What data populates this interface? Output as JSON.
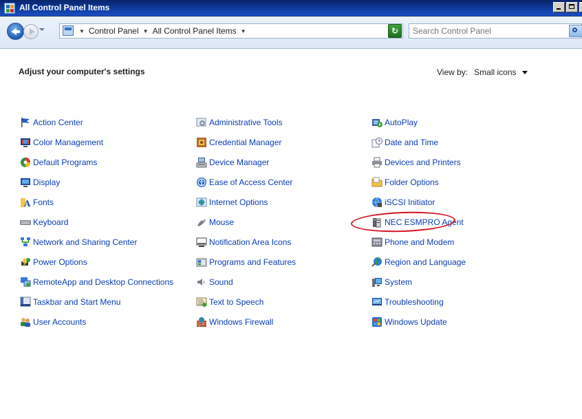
{
  "window": {
    "title": "All Control Panel Items"
  },
  "address": {
    "crumbs": [
      "Control Panel",
      "All Control Panel Items"
    ],
    "search_placeholder": "Search Control Panel"
  },
  "main": {
    "heading": "Adjust your computer's settings",
    "view_by_label": "View by:",
    "view_by_value": "Small icons"
  },
  "items": {
    "col1": [
      {
        "label": "Action Center",
        "icon": "flag-icon"
      },
      {
        "label": "Color Management",
        "icon": "color-monitor-icon"
      },
      {
        "label": "Default Programs",
        "icon": "default-programs-icon"
      },
      {
        "label": "Display",
        "icon": "display-icon"
      },
      {
        "label": "Fonts",
        "icon": "fonts-icon"
      },
      {
        "label": "Keyboard",
        "icon": "keyboard-icon"
      },
      {
        "label": "Network and Sharing Center",
        "icon": "network-icon"
      },
      {
        "label": "Power Options",
        "icon": "power-icon"
      },
      {
        "label": "RemoteApp and Desktop Connections",
        "icon": "remoteapp-icon"
      },
      {
        "label": "Taskbar and Start Menu",
        "icon": "taskbar-icon"
      },
      {
        "label": "User Accounts",
        "icon": "users-icon"
      }
    ],
    "col2": [
      {
        "label": "Administrative Tools",
        "icon": "admin-tools-icon"
      },
      {
        "label": "Credential Manager",
        "icon": "credential-icon"
      },
      {
        "label": "Device Manager",
        "icon": "device-manager-icon"
      },
      {
        "label": "Ease of Access Center",
        "icon": "ease-of-access-icon"
      },
      {
        "label": "Internet Options",
        "icon": "internet-options-icon"
      },
      {
        "label": "Mouse",
        "icon": "mouse-icon"
      },
      {
        "label": "Notification Area Icons",
        "icon": "notification-icon"
      },
      {
        "label": "Programs and Features",
        "icon": "programs-icon"
      },
      {
        "label": "Sound",
        "icon": "sound-icon"
      },
      {
        "label": "Text to Speech",
        "icon": "text-to-speech-icon"
      },
      {
        "label": "Windows Firewall",
        "icon": "firewall-icon"
      }
    ],
    "col3": [
      {
        "label": "AutoPlay",
        "icon": "autoplay-icon"
      },
      {
        "label": "Date and Time",
        "icon": "clock-icon"
      },
      {
        "label": "Devices and Printers",
        "icon": "printer-icon"
      },
      {
        "label": "Folder Options",
        "icon": "folder-icon"
      },
      {
        "label": "iSCSI Initiator",
        "icon": "iscsi-icon"
      },
      {
        "label": "NEC ESMPRO Agent",
        "icon": "nec-agent-icon"
      },
      {
        "label": "Phone and Modem",
        "icon": "phone-icon"
      },
      {
        "label": "Region and Language",
        "icon": "globe-icon"
      },
      {
        "label": "System",
        "icon": "system-icon"
      },
      {
        "label": "Troubleshooting",
        "icon": "troubleshooting-icon"
      },
      {
        "label": "Windows Update",
        "icon": "windows-update-icon"
      }
    ]
  },
  "colors": {
    "link": "#0b3cb4",
    "highlight": "#d3141f",
    "titlebar": "#0c3a9a"
  }
}
